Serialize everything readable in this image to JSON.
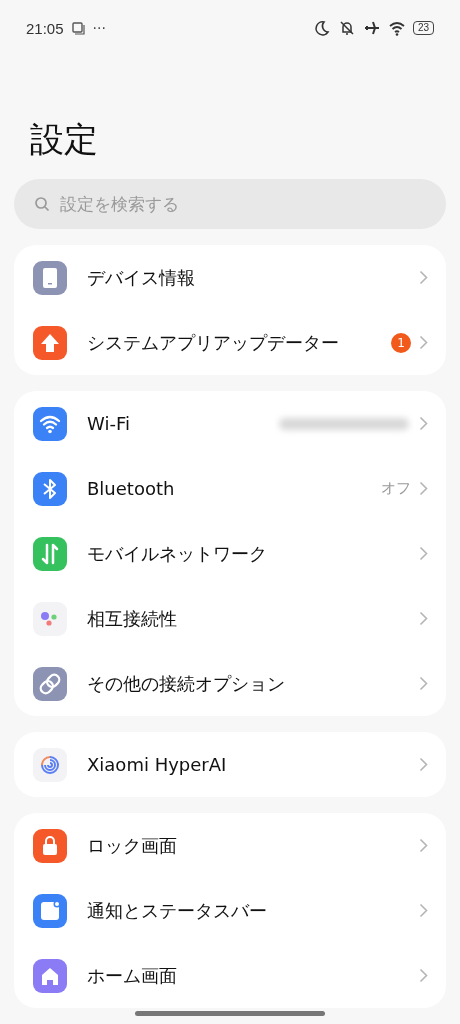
{
  "status_bar": {
    "time": "21:05",
    "more": "···",
    "battery": "23"
  },
  "title": "設定",
  "search": {
    "placeholder": "設定を検索する"
  },
  "groups": [
    {
      "items": [
        {
          "label": "デバイス情報"
        },
        {
          "label": "システムアプリアップデーター",
          "badge": "1"
        }
      ]
    },
    {
      "items": [
        {
          "label": "Wi-Fi",
          "value_hidden": true
        },
        {
          "label": "Bluetooth",
          "value": "オフ"
        },
        {
          "label": "モバイルネットワーク"
        },
        {
          "label": "相互接続性"
        },
        {
          "label": "その他の接続オプション"
        }
      ]
    },
    {
      "items": [
        {
          "label": "Xiaomi HyperAI"
        }
      ]
    },
    {
      "items": [
        {
          "label": "ロック画面"
        },
        {
          "label": "通知とステータスバー"
        },
        {
          "label": "ホーム画面"
        }
      ]
    }
  ]
}
